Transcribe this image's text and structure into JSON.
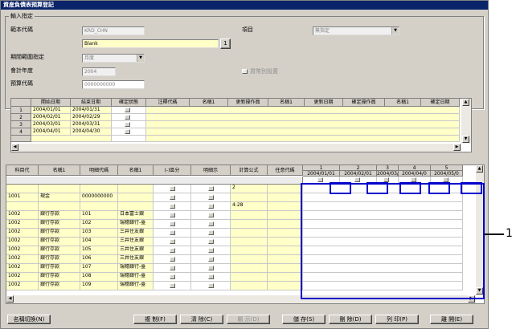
{
  "window": {
    "title": "資産負債表預算登記"
  },
  "input_group": {
    "title": "輸入指定",
    "fields": {
      "template_code_label": "範本代碼",
      "template_code_value": "KRD_CHN",
      "template_name_value": "Blank",
      "lookup_button": "1",
      "item_label": "項目",
      "item_value": "無指定",
      "period_label": "期間範圍指定",
      "period_value": "月度",
      "fiscal_year_label": "會計年度",
      "fiscal_year_value": "2004",
      "currency_checkbox_label": "貨幣別設置",
      "budget_code_label": "預算代碼",
      "budget_code_value": "0000000000"
    }
  },
  "period_grid": {
    "headers": [
      "開始日期",
      "結束日期",
      "確定狀態",
      "注釋代碼",
      "名稱1",
      "更新操作員",
      "名稱1",
      "更新日期",
      "確定操作員",
      "名稱1",
      "確定日期"
    ],
    "rows": [
      {
        "no": "1",
        "start": "2004/01/01",
        "end": "2004/01/31"
      },
      {
        "no": "2",
        "start": "2004/02/01",
        "end": "2004/02/29"
      },
      {
        "no": "3",
        "start": "2004/03/01",
        "end": "2004/03/31"
      },
      {
        "no": "4",
        "start": "2004/04/01",
        "end": "2004/04/30"
      }
    ]
  },
  "account_grid": {
    "headers": [
      "科目代",
      "名稱1",
      "明細代碼",
      "名稱1",
      "(-)區分",
      "明細示",
      "計算公式",
      "任意代碼"
    ],
    "period_headers": [
      {
        "num": "1",
        "date": "2004/01/01"
      },
      {
        "num": "2",
        "date": "2004/02/01"
      },
      {
        "num": "3",
        "date": "2004/03/0"
      },
      {
        "num": "4",
        "date": "2004/04/0"
      },
      {
        "num": "5",
        "date": "2004/05/0"
      }
    ],
    "row_values": {
      "formula_1": "2",
      "formula_2": "4:28"
    },
    "rows": [
      {
        "code": "1001",
        "name": "現金",
        "detail": "0000000000",
        "dname": ""
      },
      {
        "code": "",
        "name": "",
        "detail": "",
        "dname": ""
      },
      {
        "code": "",
        "name": "",
        "detail": "",
        "dname": ""
      },
      {
        "code": "1002",
        "name": "銀行存款",
        "detail": "101",
        "dname": "日本富士銀"
      },
      {
        "code": "1002",
        "name": "銀行存款",
        "detail": "102",
        "dname": "瑞穗銀行-臺"
      },
      {
        "code": "1002",
        "name": "銀行存款",
        "detail": "103",
        "dname": "三井住友銀"
      },
      {
        "code": "1002",
        "name": "銀行存款",
        "detail": "104",
        "dname": "三井住友銀"
      },
      {
        "code": "1002",
        "name": "銀行存款",
        "detail": "105",
        "dname": "三井住友銀"
      },
      {
        "code": "1002",
        "name": "銀行存款",
        "detail": "106",
        "dname": "三井住友銀"
      },
      {
        "code": "1002",
        "name": "銀行存款",
        "detail": "107",
        "dname": "瑞穗銀行-臺"
      },
      {
        "code": "1002",
        "name": "銀行存款",
        "detail": "108",
        "dname": "瑞穗銀行-臺"
      },
      {
        "code": "1002",
        "name": "銀行存款",
        "detail": "109",
        "dname": "瑞穗銀行-臺"
      }
    ]
  },
  "buttons": {
    "name_switch": "名稱切換(N)",
    "copy": "複 制(F)",
    "clear": "清 除(C)",
    "display": "顯 示(D)",
    "save": "儲 存(S)",
    "delete": "刪 除(D)",
    "print": "列 印(P)",
    "close": "離 開(E)"
  },
  "annotation": {
    "callout_number": "1"
  },
  "colors": {
    "title_bar": "#0a246a",
    "highlight": "#0000cc",
    "cell_yellow": "#ffffc8"
  }
}
